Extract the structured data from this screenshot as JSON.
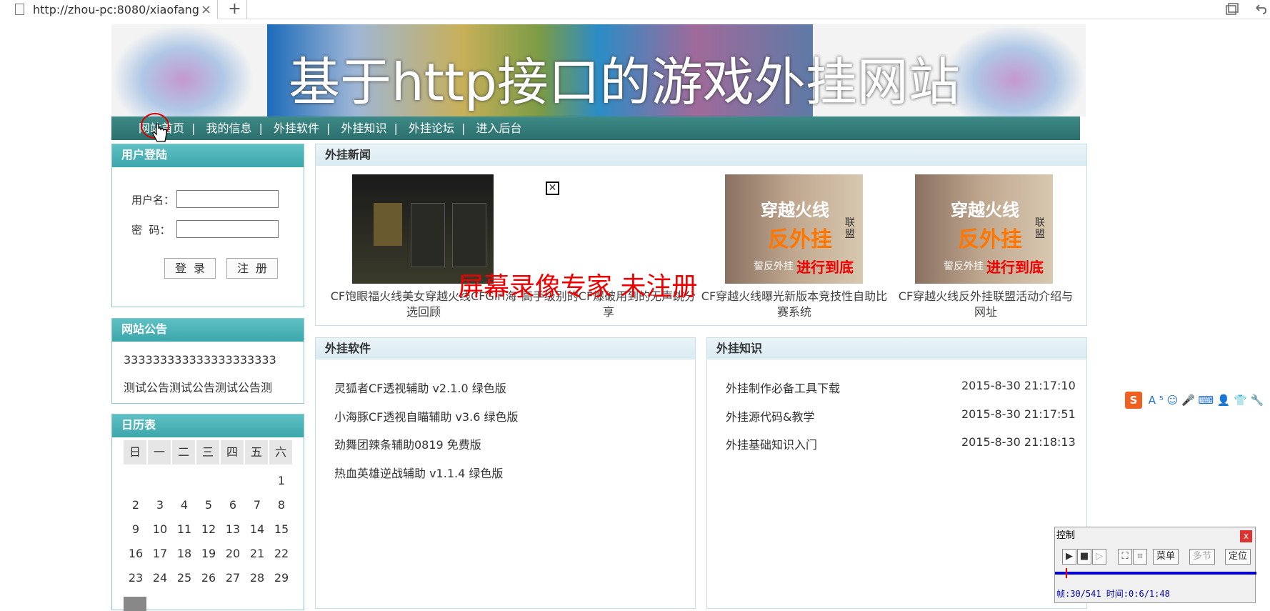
{
  "browser": {
    "tab_title": "http://zhou-pc:8080/xiaofang",
    "close_glyph": "×",
    "new_tab_glyph": "+"
  },
  "site": {
    "banner_title": "基于http接口的游戏外挂网站",
    "nav": [
      "网站首页",
      "我的信息",
      "外挂软件",
      "外挂知识",
      "外挂论坛",
      "进入后台"
    ],
    "nav_sep": "|"
  },
  "login": {
    "header": "用户登陆",
    "username_label": "用户名：",
    "password_label": "密  码：",
    "login_button": "登录",
    "register_button": "注册"
  },
  "announcements": {
    "header": "网站公告",
    "items": [
      "333333333333333333333",
      "测试公告测试公告测试公告测"
    ]
  },
  "calendar": {
    "header": "日历表",
    "weekdays": [
      "日",
      "一",
      "二",
      "三",
      "四",
      "五",
      "六"
    ],
    "rows": [
      [
        "",
        "",
        "",
        "",
        "",
        "",
        "1"
      ],
      [
        "2",
        "3",
        "4",
        "5",
        "6",
        "7",
        "8"
      ],
      [
        "9",
        "10",
        "11",
        "12",
        "13",
        "14",
        "15"
      ],
      [
        "16",
        "17",
        "18",
        "19",
        "20",
        "21",
        "22"
      ],
      [
        "23",
        "24",
        "25",
        "26",
        "27",
        "28",
        "29"
      ]
    ]
  },
  "news": {
    "header": "外挂新闻",
    "items": [
      {
        "caption": "CF饱眼福火线美女穿越火线CFGirl海选回顾"
      },
      {
        "caption": "高手级别的CF爆破用到的无声跳分享"
      },
      {
        "caption": "CF穿越火线曝光新版本竞技性自助比赛系统"
      },
      {
        "caption": "CF穿越火线反外挂联盟活动介绍与网址"
      }
    ],
    "image_texts": {
      "cf_logo": "穿越火线",
      "anti": "反外挂",
      "alliance": "联盟",
      "slogan": "进行到底",
      "slogan_prefix": "誓反外挂"
    }
  },
  "software": {
    "header": "外挂软件",
    "items": [
      "灵狐者CF透视辅助 v2.1.0 绿色版",
      "小海豚CF透视自瞄辅助 v3.6 绿色版",
      "劲舞团辣条辅助0819 免费版",
      "热血英雄逆战辅助 v1.1.4 绿色版"
    ]
  },
  "knowledge": {
    "header": "外挂知识",
    "items": [
      {
        "title": "外挂制作必备工具下载",
        "date": "2015-8-30 21:17:10"
      },
      {
        "title": "外挂源代码&教学",
        "date": "2015-8-30 21:17:51"
      },
      {
        "title": "外挂基础知识入门",
        "date": "2015-8-30 21:18:13"
      }
    ]
  },
  "overlay": {
    "watermark": "屏幕录像专家 未注册",
    "broken_image_glyph": "✕",
    "ime_letters": "A ⁵ ☺ 🎤 ⌨ 👤 👕 🔧",
    "ime_logo": "S",
    "control": {
      "title": "控制",
      "close": "x",
      "menu": "菜单",
      "multi": "多节",
      "locate": "定位",
      "status": "帧:30/541 时间:0:6/1:48"
    }
  }
}
